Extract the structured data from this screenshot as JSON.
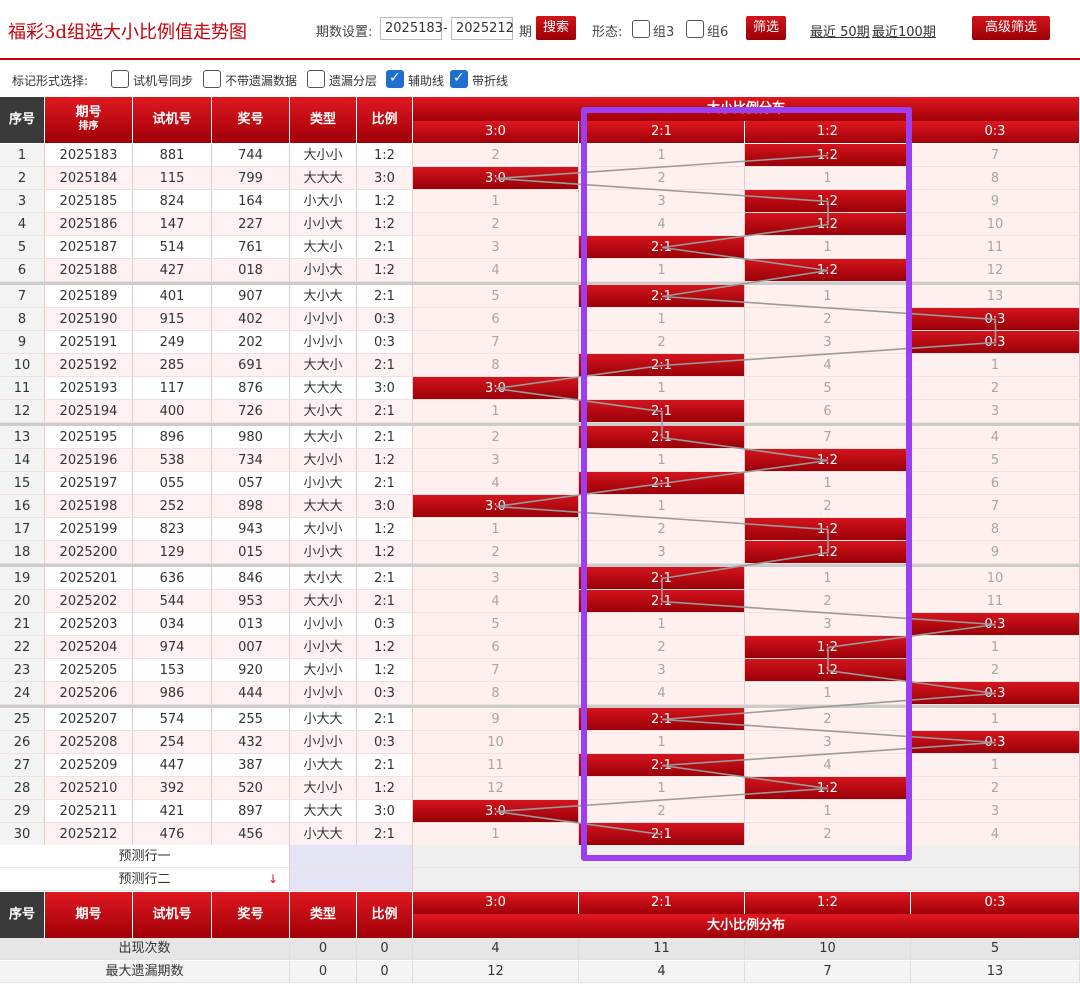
{
  "header": {
    "title": "福彩3d组选大小比例值走势图",
    "period_label": "期数设置:",
    "period_start": "2025183",
    "period_dash": "-",
    "period_end": "2025212",
    "period_unit": "期",
    "search_button": "搜索",
    "form_label": "形态:",
    "form_options": [
      "组3",
      "组6"
    ],
    "filter_button": "筛选",
    "recent_links": [
      "最近 50期",
      "最近100期"
    ],
    "advanced_button": "高级筛选"
  },
  "mark_bar": {
    "label": "标记形式选择:",
    "options": [
      {
        "label": "试机号同步",
        "checked": false
      },
      {
        "label": "不带遗漏数据",
        "checked": false
      },
      {
        "label": "遗漏分层",
        "checked": false
      },
      {
        "label": "辅助线",
        "checked": true
      },
      {
        "label": "带折线",
        "checked": true
      }
    ]
  },
  "table": {
    "headers": {
      "seq": "序号",
      "issue": "期号",
      "sort": "排序",
      "trial": "试机号",
      "prize": "奖号",
      "type": "类型",
      "ratio": "比例",
      "dist_title": "大小比例分布"
    },
    "dist_cols": [
      "3:0",
      "2:1",
      "1:2",
      "0:3"
    ],
    "rows": [
      {
        "seq": "1",
        "issue": "2025183",
        "trial": "881",
        "prize": "744",
        "type": "大小小",
        "ratio": "1:2",
        "dist": [
          "2",
          "1",
          "1:2",
          "7"
        ],
        "hit": 2
      },
      {
        "seq": "2",
        "issue": "2025184",
        "trial": "115",
        "prize": "799",
        "type": "大大大",
        "ratio": "3:0",
        "dist": [
          "3:0",
          "2",
          "1",
          "8"
        ],
        "hit": 0
      },
      {
        "seq": "3",
        "issue": "2025185",
        "trial": "824",
        "prize": "164",
        "type": "小大小",
        "ratio": "1:2",
        "dist": [
          "1",
          "3",
          "1:2",
          "9"
        ],
        "hit": 2
      },
      {
        "seq": "4",
        "issue": "2025186",
        "trial": "147",
        "prize": "227",
        "type": "小小大",
        "ratio": "1:2",
        "dist": [
          "2",
          "4",
          "1:2",
          "10"
        ],
        "hit": 2
      },
      {
        "seq": "5",
        "issue": "2025187",
        "trial": "514",
        "prize": "761",
        "type": "大大小",
        "ratio": "2:1",
        "dist": [
          "3",
          "2:1",
          "1",
          "11"
        ],
        "hit": 1
      },
      {
        "seq": "6",
        "issue": "2025188",
        "trial": "427",
        "prize": "018",
        "type": "小小大",
        "ratio": "1:2",
        "dist": [
          "4",
          "1",
          "1:2",
          "12"
        ],
        "hit": 2
      },
      {
        "seq": "7",
        "issue": "2025189",
        "trial": "401",
        "prize": "907",
        "type": "大小大",
        "ratio": "2:1",
        "dist": [
          "5",
          "2:1",
          "1",
          "13"
        ],
        "hit": 1
      },
      {
        "seq": "8",
        "issue": "2025190",
        "trial": "915",
        "prize": "402",
        "type": "小小小",
        "ratio": "0:3",
        "dist": [
          "6",
          "1",
          "2",
          "0:3"
        ],
        "hit": 3
      },
      {
        "seq": "9",
        "issue": "2025191",
        "trial": "249",
        "prize": "202",
        "type": "小小小",
        "ratio": "0:3",
        "dist": [
          "7",
          "2",
          "3",
          "0:3"
        ],
        "hit": 3
      },
      {
        "seq": "10",
        "issue": "2025192",
        "trial": "285",
        "prize": "691",
        "type": "大大小",
        "ratio": "2:1",
        "dist": [
          "8",
          "2:1",
          "4",
          "1"
        ],
        "hit": 1
      },
      {
        "seq": "11",
        "issue": "2025193",
        "trial": "117",
        "prize": "876",
        "type": "大大大",
        "ratio": "3:0",
        "dist": [
          "3:0",
          "1",
          "5",
          "2"
        ],
        "hit": 0
      },
      {
        "seq": "12",
        "issue": "2025194",
        "trial": "400",
        "prize": "726",
        "type": "大小大",
        "ratio": "2:1",
        "dist": [
          "1",
          "2:1",
          "6",
          "3"
        ],
        "hit": 1
      },
      {
        "seq": "13",
        "issue": "2025195",
        "trial": "896",
        "prize": "980",
        "type": "大大小",
        "ratio": "2:1",
        "dist": [
          "2",
          "2:1",
          "7",
          "4"
        ],
        "hit": 1
      },
      {
        "seq": "14",
        "issue": "2025196",
        "trial": "538",
        "prize": "734",
        "type": "大小小",
        "ratio": "1:2",
        "dist": [
          "3",
          "1",
          "1:2",
          "5"
        ],
        "hit": 2
      },
      {
        "seq": "15",
        "issue": "2025197",
        "trial": "055",
        "prize": "057",
        "type": "小小大",
        "ratio": "2:1",
        "dist": [
          "4",
          "2:1",
          "1",
          "6"
        ],
        "hit": 1
      },
      {
        "seq": "16",
        "issue": "2025198",
        "trial": "252",
        "prize": "898",
        "type": "大大大",
        "ratio": "3:0",
        "dist": [
          "3:0",
          "1",
          "2",
          "7"
        ],
        "hit": 0
      },
      {
        "seq": "17",
        "issue": "2025199",
        "trial": "823",
        "prize": "943",
        "type": "大小小",
        "ratio": "1:2",
        "dist": [
          "1",
          "2",
          "1:2",
          "8"
        ],
        "hit": 2
      },
      {
        "seq": "18",
        "issue": "2025200",
        "trial": "129",
        "prize": "015",
        "type": "小小大",
        "ratio": "1:2",
        "dist": [
          "2",
          "3",
          "1:2",
          "9"
        ],
        "hit": 2
      },
      {
        "seq": "19",
        "issue": "2025201",
        "trial": "636",
        "prize": "846",
        "type": "大小大",
        "ratio": "2:1",
        "dist": [
          "3",
          "2:1",
          "1",
          "10"
        ],
        "hit": 1
      },
      {
        "seq": "20",
        "issue": "2025202",
        "trial": "544",
        "prize": "953",
        "type": "大大小",
        "ratio": "2:1",
        "dist": [
          "4",
          "2:1",
          "2",
          "11"
        ],
        "hit": 1
      },
      {
        "seq": "21",
        "issue": "2025203",
        "trial": "034",
        "prize": "013",
        "type": "小小小",
        "ratio": "0:3",
        "dist": [
          "5",
          "1",
          "3",
          "0:3"
        ],
        "hit": 3
      },
      {
        "seq": "22",
        "issue": "2025204",
        "trial": "974",
        "prize": "007",
        "type": "小小大",
        "ratio": "1:2",
        "dist": [
          "6",
          "2",
          "1:2",
          "1"
        ],
        "hit": 2
      },
      {
        "seq": "23",
        "issue": "2025205",
        "trial": "153",
        "prize": "920",
        "type": "大小小",
        "ratio": "1:2",
        "dist": [
          "7",
          "3",
          "1:2",
          "2"
        ],
        "hit": 2
      },
      {
        "seq": "24",
        "issue": "2025206",
        "trial": "986",
        "prize": "444",
        "type": "小小小",
        "ratio": "0:3",
        "dist": [
          "8",
          "4",
          "1",
          "0:3"
        ],
        "hit": 3
      },
      {
        "seq": "25",
        "issue": "2025207",
        "trial": "574",
        "prize": "255",
        "type": "小大大",
        "ratio": "2:1",
        "dist": [
          "9",
          "2:1",
          "2",
          "1"
        ],
        "hit": 1
      },
      {
        "seq": "26",
        "issue": "2025208",
        "trial": "254",
        "prize": "432",
        "type": "小小小",
        "ratio": "0:3",
        "dist": [
          "10",
          "1",
          "3",
          "0:3"
        ],
        "hit": 3
      },
      {
        "seq": "27",
        "issue": "2025209",
        "trial": "447",
        "prize": "387",
        "type": "小大大",
        "ratio": "2:1",
        "dist": [
          "11",
          "2:1",
          "4",
          "1"
        ],
        "hit": 1
      },
      {
        "seq": "28",
        "issue": "2025210",
        "trial": "392",
        "prize": "520",
        "type": "大小小",
        "ratio": "1:2",
        "dist": [
          "12",
          "1",
          "1:2",
          "2"
        ],
        "hit": 2
      },
      {
        "seq": "29",
        "issue": "2025211",
        "trial": "421",
        "prize": "897",
        "type": "大大大",
        "ratio": "3:0",
        "dist": [
          "3:0",
          "2",
          "1",
          "3"
        ],
        "hit": 0
      },
      {
        "seq": "30",
        "issue": "2025212",
        "trial": "476",
        "prize": "456",
        "type": "小大大",
        "ratio": "2:1",
        "dist": [
          "1",
          "2:1",
          "2",
          "4"
        ],
        "hit": 1
      }
    ],
    "predict_rows": [
      "预测行一",
      "预测行二"
    ],
    "stats": [
      {
        "label": "出现次数",
        "type": "0",
        "ratio": "0",
        "values": [
          "4",
          "11",
          "10",
          "5"
        ]
      },
      {
        "label": "最大遗漏期数",
        "type": "0",
        "ratio": "0",
        "values": [
          "12",
          "4",
          "7",
          "13"
        ]
      }
    ]
  },
  "colors": {
    "brand_red": "#c8000a",
    "hit_red": "#b8000c",
    "focus_outline": "#9b3ff0",
    "checkbox_blue": "#1e6fd0"
  }
}
